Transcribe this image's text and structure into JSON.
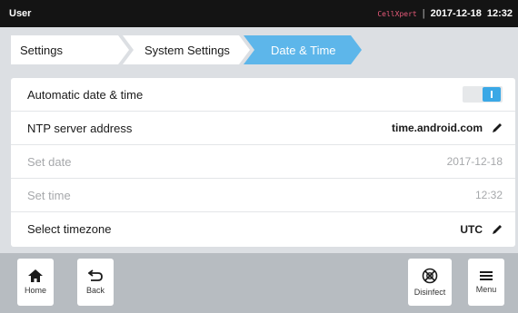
{
  "status_bar": {
    "user": "User",
    "app_name": "CellXpert",
    "separator": "|",
    "date": "2017-12-18",
    "time": "12:32"
  },
  "breadcrumb": {
    "items": [
      {
        "label": "Settings",
        "active": false
      },
      {
        "label": "System Settings",
        "active": false
      },
      {
        "label": "Date & Time",
        "active": true
      }
    ]
  },
  "settings": {
    "rows": [
      {
        "label": "Automatic date & time",
        "type": "toggle",
        "value": "",
        "enabled": true,
        "toggle_on": true
      },
      {
        "label": "NTP server address",
        "type": "edit",
        "value": "time.android.com",
        "enabled": true
      },
      {
        "label": "Set date",
        "type": "text",
        "value": "2017-12-18",
        "enabled": false
      },
      {
        "label": "Set time",
        "type": "text",
        "value": "12:32",
        "enabled": false
      },
      {
        "label": "Select timezone",
        "type": "edit",
        "value": "UTC",
        "enabled": true
      }
    ]
  },
  "bottom_bar": {
    "home_label": "Home",
    "back_label": "Back",
    "disinfect_label": "Disinfect",
    "menu_label": "Menu"
  },
  "colors": {
    "accent": "#3aa8e6",
    "status_bar_bg": "#141414",
    "page_bg": "#dcdfe3",
    "bottom_bar_bg": "#b7bcc1",
    "disabled_text": "#a6a8ab"
  }
}
